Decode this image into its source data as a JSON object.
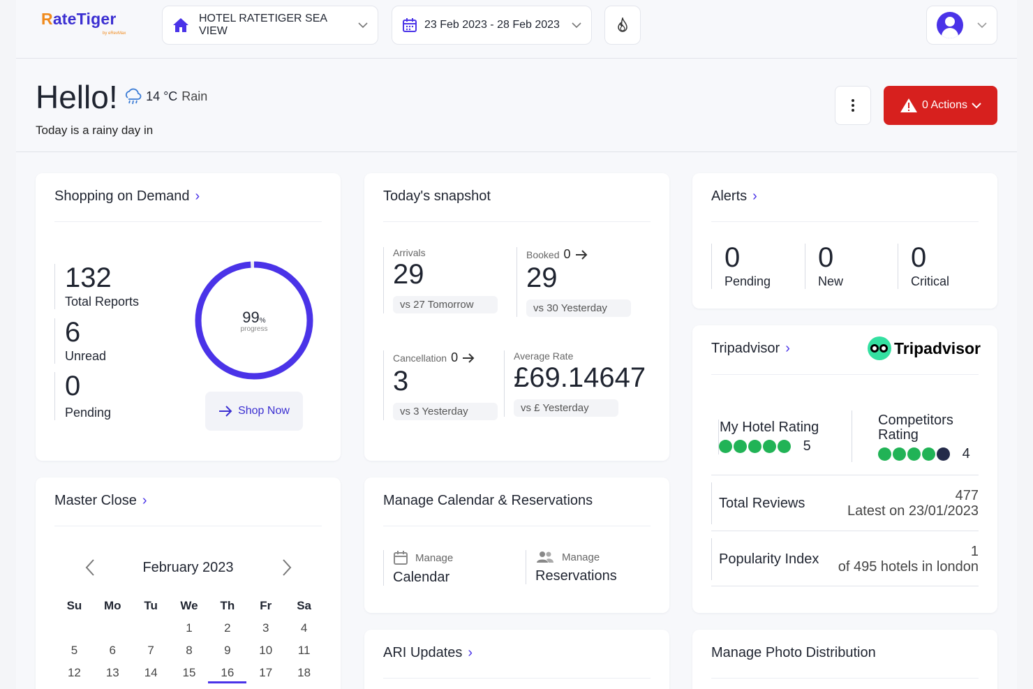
{
  "header": {
    "logo_text": "RateTiger",
    "logo_sub": "by eRevMax",
    "hotel": "HOTEL RATETIGER SEA VIEW",
    "date_range": "23 Feb 2023 - 28 Feb 2023",
    "accent": "#4a33e8"
  },
  "greeting": {
    "hello": "Hello!",
    "temp": "14 °C",
    "condition": "Rain",
    "subtitle": "Today is a rainy day in",
    "actions_label": "0 Actions",
    "actions_color": "#d7201e"
  },
  "shopping": {
    "title": "Shopping on Demand",
    "total_reports": "132",
    "total_reports_label": "Total Reports",
    "unread": "6",
    "unread_label": "Unread",
    "pending": "0",
    "pending_label": "Pending",
    "progress_value": "99",
    "progress_unit": "%",
    "progress_label": "progress",
    "progress_fraction": 0.99,
    "shop_now": "Shop Now"
  },
  "snapshot": {
    "title": "Today's snapshot",
    "arrivals_label": "Arrivals",
    "arrivals": "29",
    "arrivals_cmp": "vs 27 Tomorrow",
    "booked_label": "Booked",
    "booked_delta": "0",
    "booked": "29",
    "booked_cmp": "vs 30 Yesterday",
    "cancel_label": "Cancellation",
    "cancel_delta": "0",
    "cancel": "3",
    "cancel_cmp": "vs 3 Yesterday",
    "avg_label": "Average Rate",
    "avg": "£69.14647",
    "avg_cmp": "vs £ Yesterday"
  },
  "alerts": {
    "title": "Alerts",
    "pending": "0",
    "pending_label": "Pending",
    "new": "0",
    "new_label": "New",
    "critical": "0",
    "critical_label": "Critical"
  },
  "tripadvisor": {
    "title": "Tripadvisor",
    "brand": "Tripadvisor",
    "my_rating_label": "My Hotel Rating",
    "my_rating": "5",
    "comp_rating_label_1": "Competitors",
    "comp_rating_label_2": "Rating",
    "comp_rating": "4",
    "total_reviews_label": "Total Reviews",
    "total_reviews": "477",
    "latest": "Latest on 23/01/2023",
    "popularity_label": "Popularity Index",
    "popularity": "1",
    "popularity_of": "of 495 hotels in london"
  },
  "master_close": {
    "title": "Master Close",
    "month": "February 2023",
    "dow": [
      "Su",
      "Mo",
      "Tu",
      "We",
      "Th",
      "Fr",
      "Sa"
    ],
    "weeks": [
      [
        "",
        "",
        "",
        "1",
        "2",
        "3",
        "4"
      ],
      [
        "5",
        "6",
        "7",
        "8",
        "9",
        "10",
        "11"
      ],
      [
        "12",
        "13",
        "14",
        "15",
        "16",
        "17",
        "18"
      ]
    ],
    "today": "16"
  },
  "manage_calendar": {
    "title": "Manage Calendar & Reservations",
    "cal_small": "Manage",
    "cal_big": "Calendar",
    "res_small": "Manage",
    "res_big": "Reservations"
  },
  "ari": {
    "title": "ARI Updates"
  },
  "photo": {
    "title": "Manage Photo Distribution"
  }
}
